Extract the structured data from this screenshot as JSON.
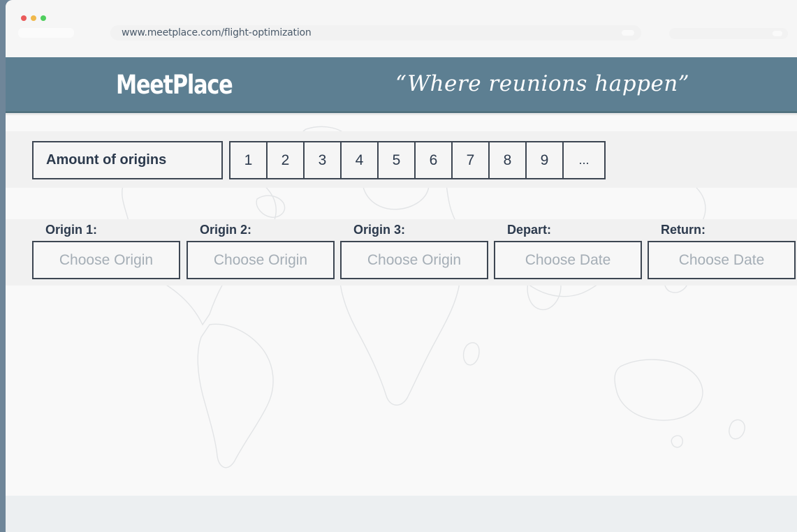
{
  "browser": {
    "url": "www.meetplace.com/flight-optimization"
  },
  "header": {
    "logo": "MeetPlace",
    "tagline": "“Where reunions happen”"
  },
  "origins_selector": {
    "label": "Amount of origins",
    "options": [
      "1",
      "2",
      "3",
      "4",
      "5",
      "6",
      "7",
      "8",
      "9",
      "..."
    ]
  },
  "fields": [
    {
      "label": "Origin 1:",
      "placeholder": "Choose Origin"
    },
    {
      "label": "Origin 2:",
      "placeholder": "Choose Origin"
    },
    {
      "label": "Origin 3:",
      "placeholder": "Choose Origin"
    },
    {
      "label": "Depart:",
      "placeholder": "Choose Date"
    },
    {
      "label": "Return:",
      "placeholder": "Choose Date"
    }
  ],
  "colors": {
    "header_bg": "#5d7f92",
    "frame_bg": "#6f8699",
    "text_dark": "#2c3a4d",
    "placeholder": "#a5aeb6"
  },
  "icons": {
    "window_controls": [
      "close-dot",
      "minimize-dot",
      "maximize-dot"
    ],
    "background": "world-map-outline"
  }
}
